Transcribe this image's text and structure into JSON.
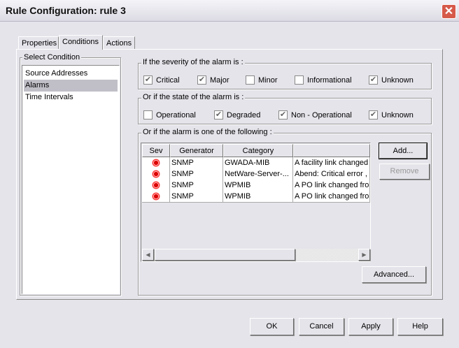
{
  "window": {
    "title": "Rule Configuration: rule 3"
  },
  "tabs": [
    {
      "label": "Properties"
    },
    {
      "label": "Conditions"
    },
    {
      "label": "Actions"
    }
  ],
  "select_condition": {
    "label": "Select Condition",
    "items": [
      "Source Addresses",
      "Alarms",
      "Time Intervals"
    ],
    "selected": "Alarms"
  },
  "severity": {
    "label": "If the severity of the alarm is :",
    "options": [
      {
        "label": "Critical",
        "checked": true
      },
      {
        "label": "Major",
        "checked": true
      },
      {
        "label": "Minor",
        "checked": false
      },
      {
        "label": "Informational",
        "checked": false
      },
      {
        "label": "Unknown",
        "checked": true
      }
    ]
  },
  "state": {
    "label": "Or if the state of the alarm is :",
    "options": [
      {
        "label": "Operational",
        "checked": false
      },
      {
        "label": "Degraded",
        "checked": true
      },
      {
        "label": "Non - Operational",
        "checked": true
      },
      {
        "label": "Unknown",
        "checked": true
      }
    ]
  },
  "alarms": {
    "label": "Or if the alarm is one of the following :",
    "columns": [
      "Sev",
      "Generator",
      "Category",
      ""
    ],
    "rows": [
      {
        "generator": "SNMP",
        "category": "GWADA-MIB",
        "description": "A facility link changed"
      },
      {
        "generator": "SNMP",
        "category": "NetWare-Server-...",
        "description": "Abend: Critical error ,"
      },
      {
        "generator": "SNMP",
        "category": "WPMIB",
        "description": "A PO link changed fro"
      },
      {
        "generator": "SNMP",
        "category": "WPMIB",
        "description": "A PO link changed fro"
      }
    ],
    "add": "Add...",
    "remove": "Remove",
    "advanced": "Advanced..."
  },
  "footer": {
    "ok": "OK",
    "cancel": "Cancel",
    "apply": "Apply",
    "help": "Help"
  }
}
